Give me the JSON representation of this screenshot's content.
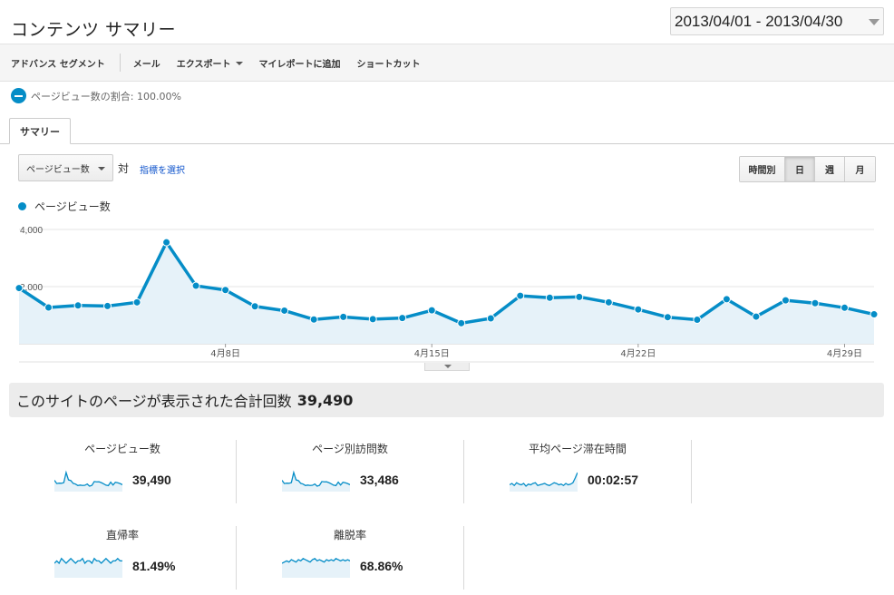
{
  "page": {
    "title": "コンテンツ サマリー"
  },
  "date_range": "2013/04/01 - 2013/04/30",
  "toolbar": {
    "items": [
      "アドバンス セグメント",
      "メール",
      "エクスポート",
      "マイレポートに追加",
      "ショートカット"
    ]
  },
  "segment": {
    "text": "ページビュー数の割合: 100.00%"
  },
  "tabs": [
    {
      "label": "サマリー",
      "active": true
    }
  ],
  "controls": {
    "metric_select": "ページビュー数",
    "vs_label": "対",
    "choose_metric": "指標を選択",
    "periods": [
      {
        "label": "時間別",
        "active": false
      },
      {
        "label": "日",
        "active": true
      },
      {
        "label": "週",
        "active": false
      },
      {
        "label": "月",
        "active": false
      }
    ]
  },
  "chart_data": {
    "type": "area",
    "series": [
      {
        "name": "ページビュー数",
        "color": "#058dc7",
        "x": [
          "2013-04-01",
          "2013-04-02",
          "2013-04-03",
          "2013-04-04",
          "2013-04-05",
          "2013-04-06",
          "2013-04-07",
          "2013-04-08",
          "2013-04-09",
          "2013-04-10",
          "2013-04-11",
          "2013-04-12",
          "2013-04-13",
          "2013-04-14",
          "2013-04-15",
          "2013-04-16",
          "2013-04-17",
          "2013-04-18",
          "2013-04-19",
          "2013-04-20",
          "2013-04-21",
          "2013-04-22",
          "2013-04-23",
          "2013-04-24",
          "2013-04-25",
          "2013-04-26",
          "2013-04-27",
          "2013-04-28",
          "2013-04-29",
          "2013-04-30"
        ],
        "values": [
          1950,
          1270,
          1340,
          1320,
          1450,
          3550,
          2030,
          1880,
          1310,
          1160,
          850,
          940,
          860,
          900,
          1170,
          720,
          890,
          1680,
          1610,
          1640,
          1450,
          1200,
          930,
          840,
          1560,
          950,
          1520,
          1420,
          1260,
          1030
        ]
      }
    ],
    "y_ticks": [
      "4,000",
      "2,000"
    ],
    "ylim": [
      0,
      4000
    ],
    "x_ticks": [
      "4月8日",
      "4月15日",
      "4月22日",
      "4月29日"
    ],
    "grid": true
  },
  "summary": {
    "label": "このサイトのページが表示された合計回数",
    "value": "39,490"
  },
  "stats": [
    {
      "label": "ページビュー数",
      "value": "39,490",
      "spark": "pageviews"
    },
    {
      "label": "ページ別訪問数",
      "value": "33,486",
      "spark": "pageviews"
    },
    {
      "label": "平均ページ滞在時間",
      "value": "00:02:57",
      "spark": "time"
    },
    {
      "label": "直帰率",
      "value": "81.49%",
      "spark": "flat"
    },
    {
      "label": "離脱率",
      "value": "68.86%",
      "spark": "flat2"
    }
  ]
}
